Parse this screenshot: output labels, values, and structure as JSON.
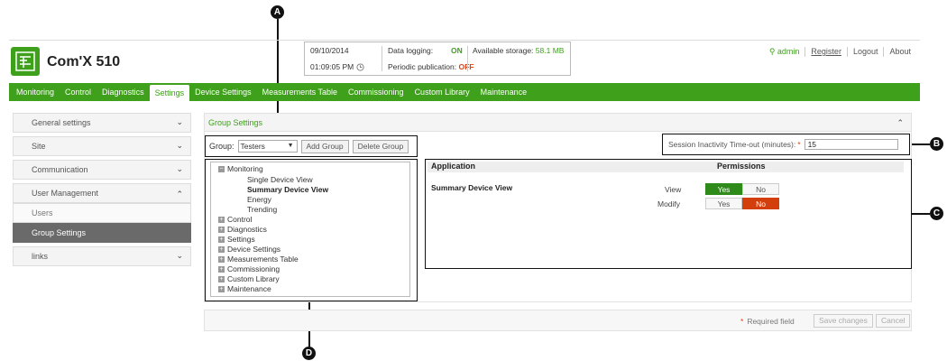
{
  "callouts": {
    "a": "A",
    "b": "B",
    "c": "C",
    "d": "D"
  },
  "app": {
    "title": "Com'X 510"
  },
  "status": {
    "date": "09/10/2014",
    "time": "01:09:05 PM",
    "data_logging_label": "Data logging:",
    "data_logging_value": "ON",
    "periodic_label": "Periodic publication:",
    "periodic_value": "OFF",
    "storage_label": "Available storage:",
    "storage_value": "58.1 MB"
  },
  "toplinks": {
    "user": "admin",
    "register": "Register",
    "logout": "Logout",
    "about": "About"
  },
  "nav": [
    "Monitoring",
    "Control",
    "Diagnostics",
    "Settings",
    "Device Settings",
    "Measurements Table",
    "Commissioning",
    "Custom Library",
    "Maintenance"
  ],
  "nav_active": "Settings",
  "sidebar": {
    "general": "General settings",
    "site": "Site",
    "communication": "Communication",
    "user_mgmt": "User Management",
    "users": "Users",
    "group_settings": "Group Settings",
    "links": "links"
  },
  "main": {
    "header": "Group Settings",
    "group_label": "Group:",
    "group_value": "Testers",
    "add_group": "Add Group",
    "delete_group": "Delete Group",
    "session_label": "Session Inactivity Time-out (minutes):",
    "session_required": "*",
    "session_value": "15"
  },
  "tree": {
    "monitoring": "Monitoring",
    "single": "Single Device View",
    "summary": "Summary Device View",
    "energy": "Energy",
    "trending": "Trending",
    "control": "Control",
    "diagnostics": "Diagnostics",
    "settings": "Settings",
    "device_settings": "Device Settings",
    "measurements": "Measurements Table",
    "commissioning": "Commissioning",
    "custom_library": "Custom Library",
    "maintenance": "Maintenance"
  },
  "permissions": {
    "col_application": "Application",
    "col_permissions": "Permissions",
    "app_name": "Summary Device View",
    "view_label": "View",
    "modify_label": "Modify",
    "yes": "Yes",
    "no": "No"
  },
  "footer": {
    "required_star": "*",
    "required_text": "Required field",
    "save": "Save changes",
    "cancel": "Cancel"
  },
  "colors": {
    "brand_green": "#3ea01b",
    "red": "#d23f0d",
    "dark_active": "#6a6a6a"
  }
}
